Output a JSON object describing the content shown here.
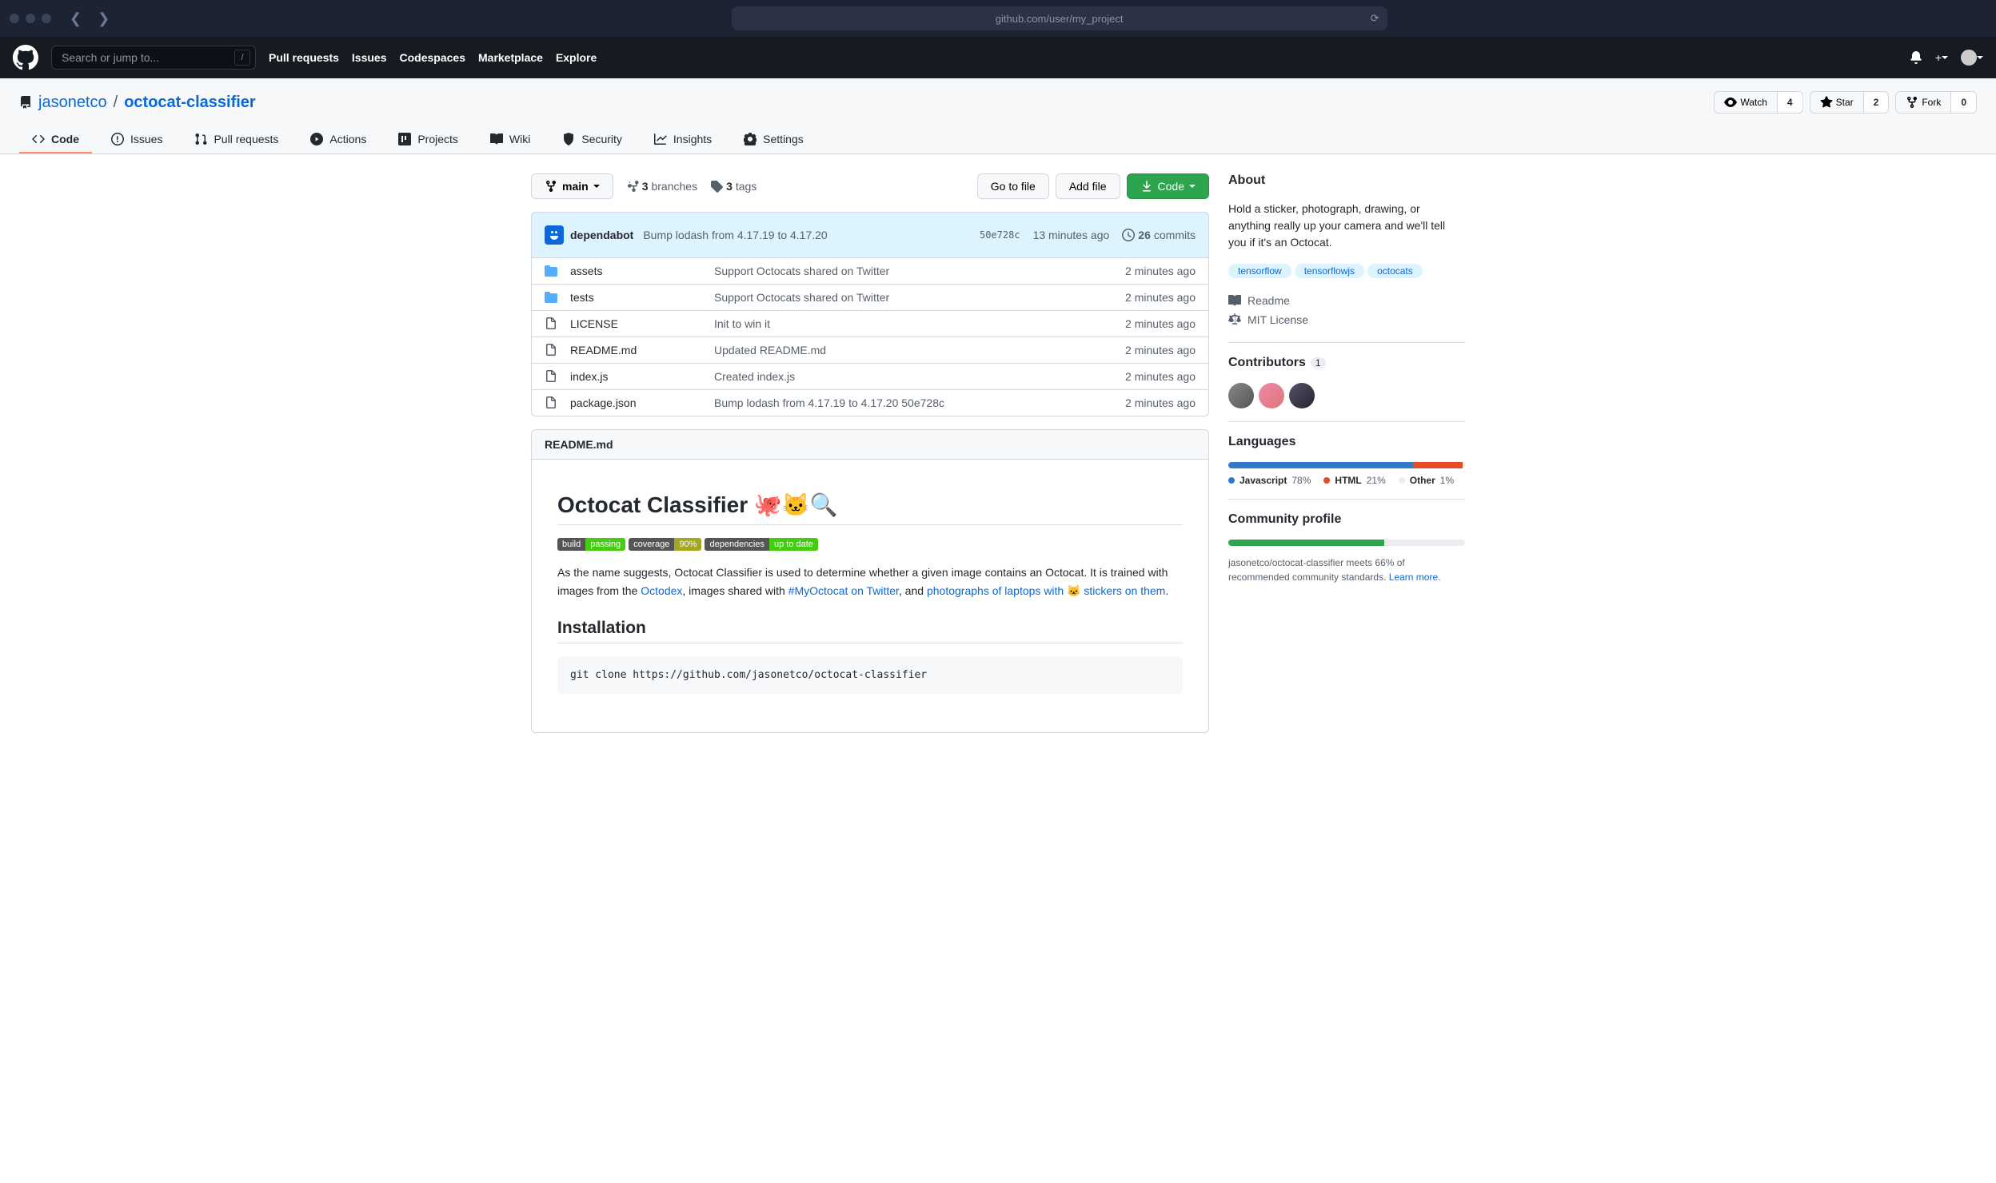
{
  "browser": {
    "url": "github.com/user/my_project"
  },
  "header": {
    "search_placeholder": "Search or jump to...",
    "nav": [
      "Pull requests",
      "Issues",
      "Codespaces",
      "Marketplace",
      "Explore"
    ]
  },
  "repo": {
    "owner": "jasonetco",
    "name": "octocat-classifier",
    "watch_label": "Watch",
    "watch_count": "4",
    "star_label": "Star",
    "star_count": "2",
    "fork_label": "Fork",
    "fork_count": "0"
  },
  "tabs": [
    {
      "label": "Code",
      "active": true
    },
    {
      "label": "Issues"
    },
    {
      "label": "Pull requests"
    },
    {
      "label": "Actions"
    },
    {
      "label": "Projects"
    },
    {
      "label": "Wiki"
    },
    {
      "label": "Security"
    },
    {
      "label": "Insights"
    },
    {
      "label": "Settings"
    }
  ],
  "filenav": {
    "branch": "main",
    "branches_count": "3",
    "branches_label": "branches",
    "tags_count": "3",
    "tags_label": "tags",
    "go_to_file": "Go to file",
    "add_file": "Add file",
    "code_btn": "Code"
  },
  "commit": {
    "author": "dependabot",
    "message": "Bump lodash from 4.17.19 to 4.17.20",
    "sha": "50e728c",
    "time": "13 minutes ago",
    "commits_count": "26",
    "commits_label": "commits"
  },
  "files": [
    {
      "type": "dir",
      "name": "assets",
      "msg": "Support Octocats shared on Twitter",
      "time": "2 minutes ago"
    },
    {
      "type": "dir",
      "name": "tests",
      "msg": "Support Octocats shared on Twitter",
      "time": "2 minutes ago"
    },
    {
      "type": "file",
      "name": "LICENSE",
      "msg": "Init to win it",
      "time": "2 minutes ago"
    },
    {
      "type": "file",
      "name": "README.md",
      "msg": "Updated README.md",
      "time": "2 minutes ago"
    },
    {
      "type": "file",
      "name": "index.js",
      "msg": "Created index.js",
      "time": "2 minutes ago"
    },
    {
      "type": "file",
      "name": "package.json",
      "msg": "Bump lodash from 4.17.19 to 4.17.20 50e728c",
      "time": "2 minutes ago"
    }
  ],
  "readme": {
    "filename": "README.md",
    "title": "Octocat Classifier 🐙🐱🔍",
    "badges": [
      {
        "left": "build",
        "right": "passing",
        "cls": "br-green"
      },
      {
        "left": "coverage",
        "right": "90%",
        "cls": "br-yellow"
      },
      {
        "left": "dependencies",
        "right": "up to date",
        "cls": "br-green"
      }
    ],
    "para_pre": "As the name suggests, Octocat Classifier is used to determine whether a given image contains an Octocat. It is trained with images from the ",
    "link1": "Octodex",
    "para_mid1": ", images shared with ",
    "link2": "#MyOctocat on Twitter",
    "para_mid2": ", and ",
    "link3": "photographs of laptops with 🐱 stickers on them",
    "para_end": ".",
    "h2": "Installation",
    "code": "git clone https://github.com/jasonetco/octocat-classifier"
  },
  "about": {
    "title": "About",
    "desc": "Hold a sticker, photograph, drawing, or anything really up your camera and we'll tell you if it's an Octocat.",
    "topics": [
      "tensorflow",
      "tensorflowjs",
      "octocats"
    ],
    "readme": "Readme",
    "license": "MIT License"
  },
  "contributors": {
    "title": "Contributors",
    "count": "1"
  },
  "languages": {
    "title": "Languages",
    "items": [
      {
        "name": "Javascript",
        "pct": "78%",
        "color": "#3178c6",
        "width": "78%"
      },
      {
        "name": "HTML",
        "pct": "21%",
        "color": "#e34c26",
        "width": "21%"
      },
      {
        "name": "Other",
        "pct": "1%",
        "color": "#ededed",
        "width": "1%"
      }
    ]
  },
  "community": {
    "title": "Community profile",
    "pct": "66%",
    "text_pre": "jasonetco/octocat-classifier meets 66% of recommended community standards. ",
    "link": "Learn more",
    "text_post": "."
  }
}
